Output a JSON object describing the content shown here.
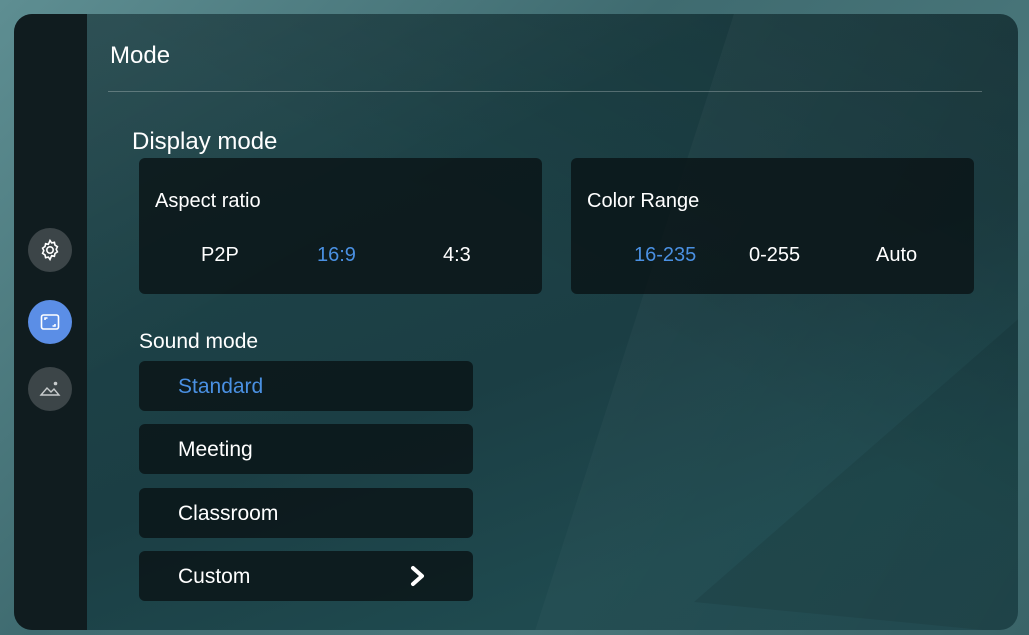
{
  "header": {
    "title": "Mode"
  },
  "sidebar": {
    "items": [
      {
        "name": "settings",
        "icon": "settings-gear-icon",
        "active": false
      },
      {
        "name": "display",
        "icon": "aspect-frame-icon",
        "active": true
      },
      {
        "name": "picture",
        "icon": "picture-mountain-icon",
        "active": false
      }
    ]
  },
  "display_mode": {
    "title": "Display mode",
    "aspect_ratio": {
      "label": "Aspect ratio",
      "options": [
        "P2P",
        "16:9",
        "4:3"
      ],
      "selected": "16:9"
    },
    "color_range": {
      "label": "Color Range",
      "options": [
        "16-235",
        "0-255",
        "Auto"
      ],
      "selected": "16-235"
    }
  },
  "sound_mode": {
    "title": "Sound mode",
    "items": [
      "Standard",
      "Meeting",
      "Classroom",
      "Custom"
    ],
    "selected": "Standard"
  },
  "colors": {
    "accent": "#4a90e2",
    "sidebar_active": "#5b8ee6"
  }
}
